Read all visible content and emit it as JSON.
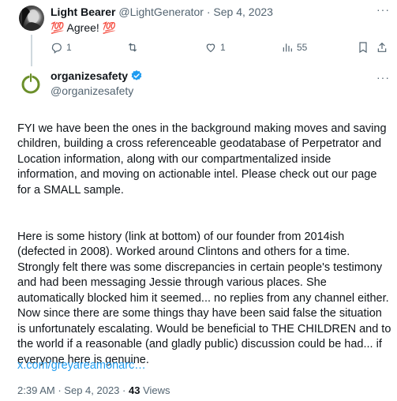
{
  "reply": {
    "author_name": "Light Bearer",
    "author_handle": "@LightGenerator",
    "separator": "·",
    "date": "Sep 4, 2023",
    "text": "💯 Agree! 💯",
    "more_label": "···",
    "actions": {
      "reply_count": "1",
      "retweet_count": "",
      "like_count": "1",
      "views_count": "55"
    }
  },
  "tweet": {
    "author_name": "organizesafety",
    "author_handle": "@organizesafety",
    "verified": true,
    "more_label": "···",
    "paragraphs": [
      "FYI we have been the ones in the background making moves and saving children, building a cross referenceable geodatabase of Perpetrator and Location information, along with our compartmentalized inside information, and moving on actionable intel. Please check out our page for a SMALL sample.",
      "Here is some history (link at bottom) of our founder from 2014ish (defected in 2008). Worked around Clintons and others for a time. Strongly felt there was some discrepancies in certain people's testimony and had been messaging Jessie through various places. She automatically blocked him it seemed... no replies from any channel either. Now since there are some things thay have been said false the situation is unfortunately escalating. Would be beneficial to THE CHILDREN and to the world if a reasonable (and gladly public) discussion could be had... if everyone here is genuine."
    ],
    "link_text": "x.com/greyareamonarc…",
    "time": "2:39 AM",
    "separator": "·",
    "date": "Sep 4, 2023",
    "separator2": "·",
    "views_count": "43",
    "views_label": "Views"
  },
  "colors": {
    "text": "#0f1419",
    "muted": "#536471",
    "link": "#1d9bf0",
    "verified": "#1d9bf0",
    "logo_green": "#6b8f2a"
  },
  "icons": [
    "reply-icon",
    "retweet-icon",
    "like-icon",
    "views-icon",
    "bookmark-icon",
    "share-icon",
    "verified-badge-icon",
    "more-icon"
  ]
}
